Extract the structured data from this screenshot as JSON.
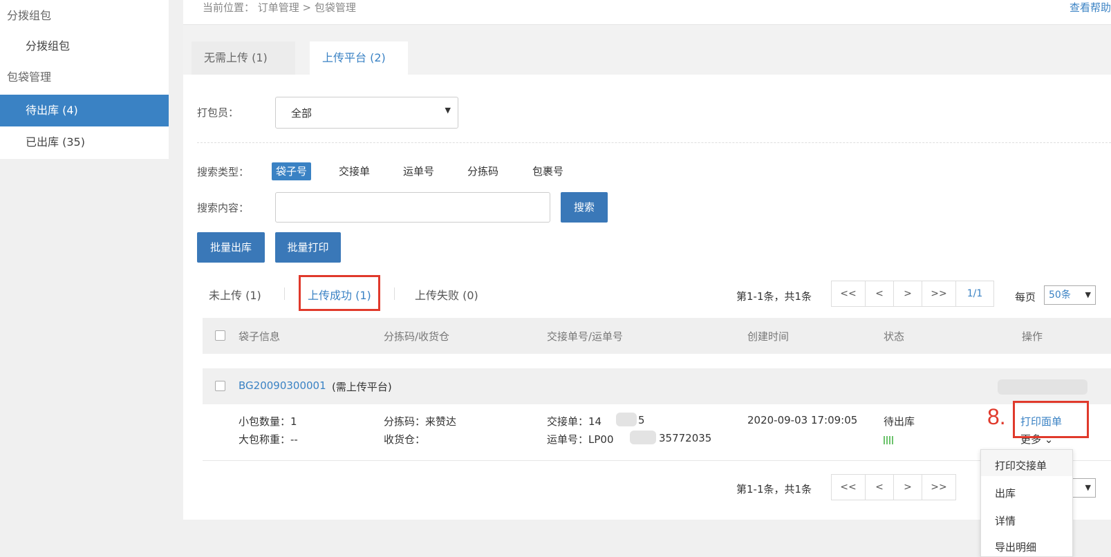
{
  "sidebar": {
    "items": [
      {
        "label": "分拨组包",
        "kind": "group"
      },
      {
        "label": "分拨组包",
        "kind": "sub"
      },
      {
        "label": "包袋管理",
        "kind": "group"
      },
      {
        "label": "待出库 (4)",
        "kind": "sub",
        "active": true
      },
      {
        "label": "已出库 (35)",
        "kind": "sub"
      }
    ]
  },
  "header": {
    "breadcrumb": "当前位置： 订单管理 > 包袋管理",
    "help_link": "查看帮助"
  },
  "platform_tabs": [
    {
      "label": "无需上传 (1)",
      "active": false
    },
    {
      "label": "上传平台 (2)",
      "active": true
    }
  ],
  "filters": {
    "packer_label": "打包员：",
    "packer_value": "全部",
    "search_type_label": "搜索类型：",
    "search_types": [
      "袋子号",
      "交接单",
      "运单号",
      "分拣码",
      "包裹号"
    ],
    "search_type_active": "袋子号",
    "search_content_label": "搜索内容：",
    "search_value": "",
    "search_button": "搜索"
  },
  "actions": {
    "batch_out": "批量出库",
    "batch_print": "批量打印"
  },
  "status_tabs": [
    {
      "label": "未上传 (1)",
      "active": false
    },
    {
      "label": "上传成功 (1)",
      "active": true
    },
    {
      "label": "上传失败 (0)",
      "active": false
    }
  ],
  "pagination": {
    "summary": "第1-1条，共1条",
    "first": "<<",
    "prev": "<",
    "next": ">",
    "last": ">>",
    "page": "1/1",
    "per_page_label": "每页",
    "per_page_value": "50条"
  },
  "table": {
    "columns": [
      "袋子信息",
      "分拣码/收货仓",
      "交接单号/运单号",
      "创建时间",
      "状态",
      "操作"
    ],
    "rows": [
      {
        "bag_id": "BG20090300001",
        "bag_note": "(需上传平台)",
        "small_count": "小包数量：1",
        "weight": "大包称重：--",
        "sort_code": "分拣码：来赞达",
        "warehouse": "收货仓：",
        "handover_prefix": "交接单：14",
        "handover_suffix": "5",
        "waybill_prefix": "运单号：LP00",
        "waybill_suffix": "35772035",
        "created": "2020-09-03 17:09:05",
        "status": "待出库",
        "action_print": "打印面单",
        "action_more": "更多"
      }
    ]
  },
  "annotation": {
    "step": "8."
  },
  "more_menu": [
    "打印交接单",
    "出库",
    "详情",
    "导出明细"
  ],
  "colors": {
    "accent": "#3a82c4",
    "highlight": "#e0392b"
  }
}
